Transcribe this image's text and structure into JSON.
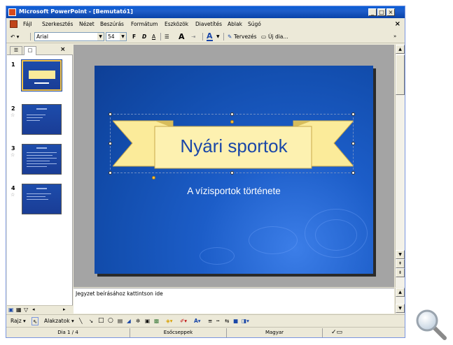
{
  "window": {
    "title": "Microsoft PowerPoint - [Bemutató1]",
    "minimize_glyph": "_",
    "restore_glyph": "□",
    "close_glyph": "×"
  },
  "menubar": {
    "items": [
      "Fájl",
      "Szerkesztés",
      "Nézet",
      "Beszúrás",
      "Formátum",
      "Eszközök",
      "Diavetítés",
      "Ablak",
      "Súgó"
    ],
    "close_glyph": "×"
  },
  "toolbar": {
    "undo": "↶ ▾",
    "font_name": "Arial",
    "font_size": "54",
    "bold": "F",
    "italic": "D",
    "underline": "A",
    "list": "☰",
    "grow_font": "A",
    "indent": "⇥",
    "font_color": "A",
    "design_label": "Tervezés",
    "new_slide_label": "Új dia..."
  },
  "left_pane": {
    "tab_outline": "☰",
    "tab_slides": "□",
    "tab_close": "×",
    "slides": [
      {
        "num": "1",
        "selected": true
      },
      {
        "num": "2",
        "selected": false
      },
      {
        "num": "3",
        "selected": false
      },
      {
        "num": "4",
        "selected": false
      }
    ],
    "star_glyph": "☆"
  },
  "slide": {
    "title": "Nyári sportok",
    "subtitle": "A vízisportok története"
  },
  "notes": {
    "placeholder": "Jegyzet beírásához kattintson ide"
  },
  "drawbar": {
    "draw_label": "Rajz ▾",
    "autoshapes_label": "Alakzatok ▾"
  },
  "statusbar": {
    "slide_info": "Dia 1 / 4",
    "design": "Esőcseppek",
    "language": "Magyar"
  },
  "colors": {
    "slide_bg": "#1c5dc8",
    "banner_fill": "#fbeb9a",
    "title_text": "#1a47a8",
    "titlebar": "#0a5fd8",
    "chrome": "#ece9d8"
  }
}
